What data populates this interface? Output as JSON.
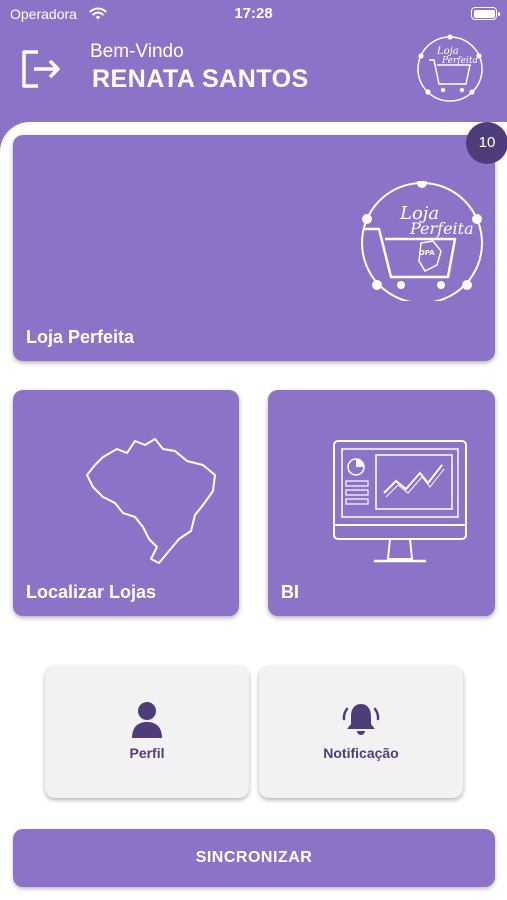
{
  "status_bar": {
    "carrier": "Operadora",
    "time": "17:28",
    "icons": [
      "wifi-icon",
      "battery-icon"
    ]
  },
  "header": {
    "welcome": "Bem-Vindo",
    "username": "RENATA SANTOS",
    "logout_icon": "logout-icon",
    "logo_icon": "loja-perfeita-logo"
  },
  "cards": {
    "main": {
      "label": "Loja Perfeita",
      "badge": "10",
      "icon": "loja-perfeita-logo"
    },
    "stores": {
      "label": "Localizar Lojas",
      "icon": "brazil-map-icon"
    },
    "bi": {
      "label": "BI",
      "icon": "monitor-chart-icon"
    }
  },
  "shortcuts": {
    "profile": {
      "label": "Perfil",
      "icon": "person-icon"
    },
    "notifications": {
      "label": "Notificação",
      "icon": "bell-icon"
    }
  },
  "sync_button": {
    "label": "SINCRONIZAR"
  },
  "colors": {
    "primary": "#8c73c8",
    "dark": "#4f3d79",
    "card_light": "#f2f2f2"
  }
}
